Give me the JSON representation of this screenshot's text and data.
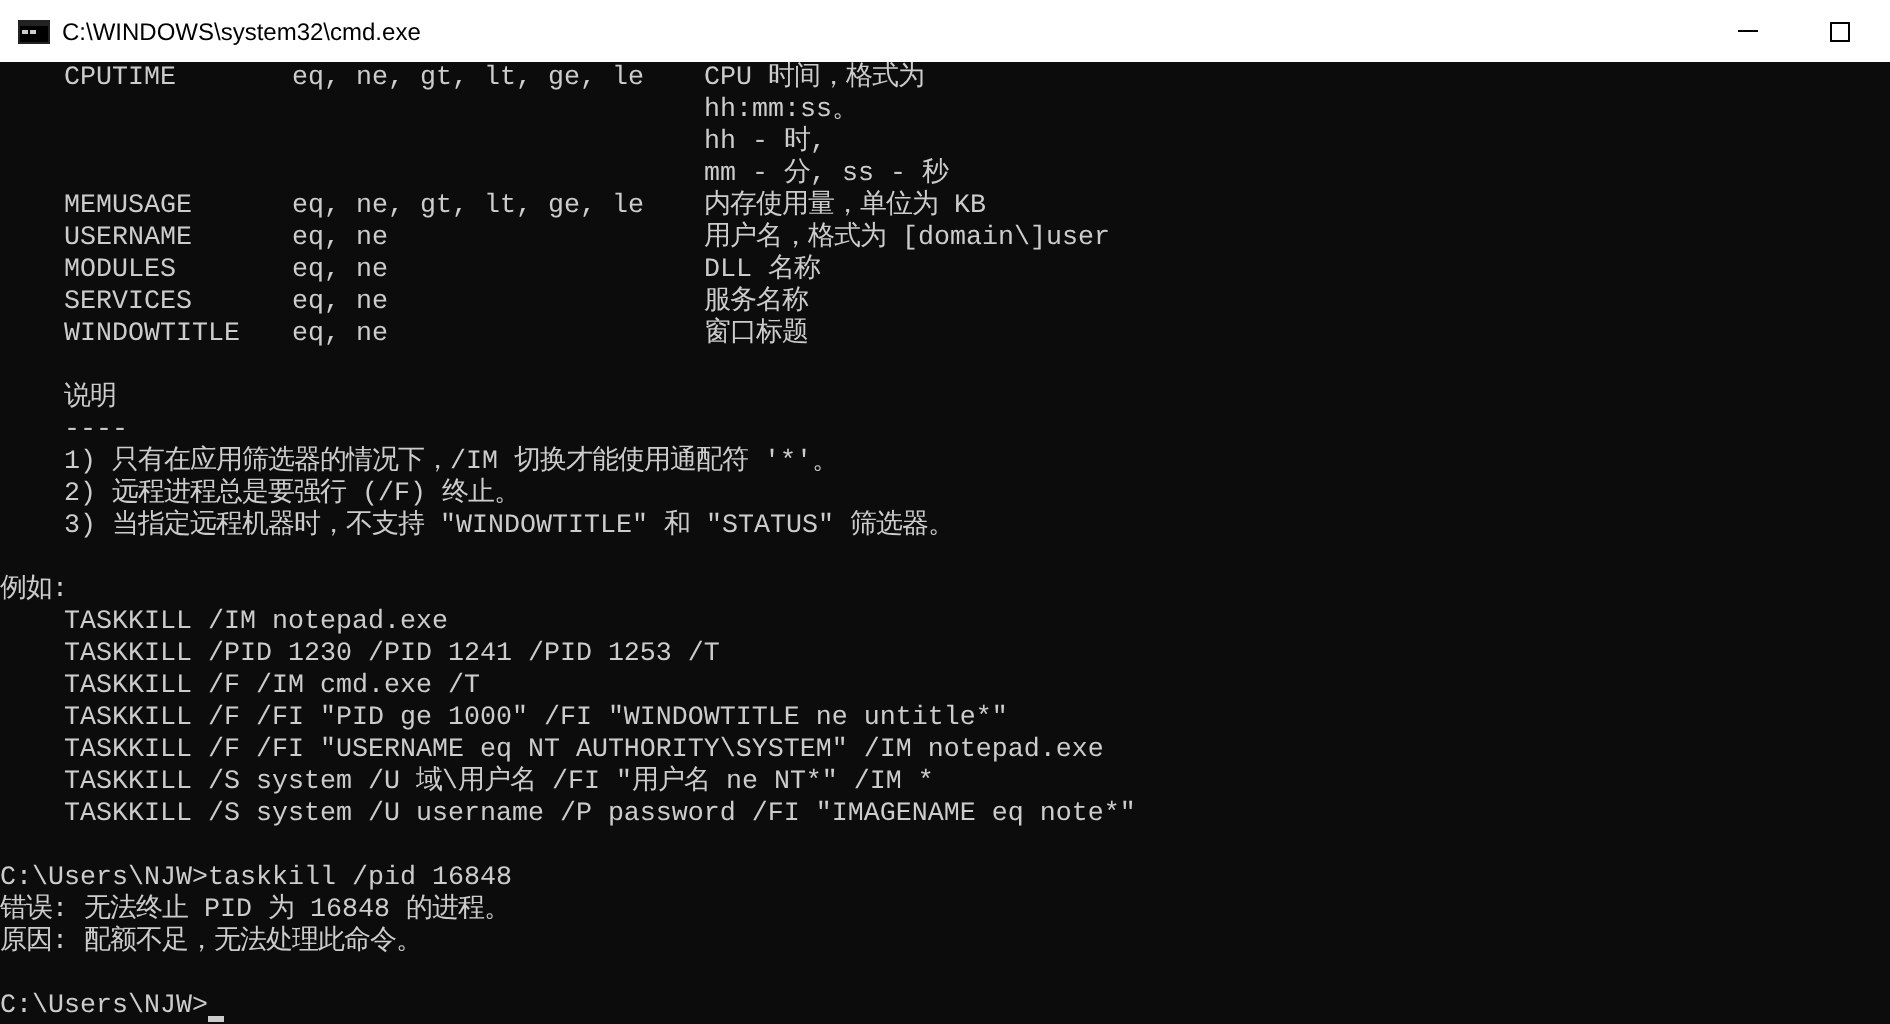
{
  "window": {
    "title": "C:\\WINDOWS\\system32\\cmd.exe"
  },
  "filters": [
    {
      "name": "CPUTIME",
      "operators": "eq, ne, gt, lt, ge, le",
      "description": [
        "CPU 时间，格式为",
        "hh:mm:ss。",
        "hh - 时,",
        "mm - 分, ss - 秒"
      ]
    },
    {
      "name": "MEMUSAGE",
      "operators": "eq, ne, gt, lt, ge, le",
      "description": [
        "内存使用量，单位为 KB"
      ]
    },
    {
      "name": "USERNAME",
      "operators": "eq, ne",
      "description": [
        "用户名，格式为 [domain\\]user"
      ]
    },
    {
      "name": "MODULES",
      "operators": "eq, ne",
      "description": [
        "DLL 名称"
      ]
    },
    {
      "name": "SERVICES",
      "operators": "eq, ne",
      "description": [
        "服务名称"
      ]
    },
    {
      "name": "WINDOWTITLE",
      "operators": "eq, ne",
      "description": [
        "窗口标题"
      ]
    }
  ],
  "notes": {
    "heading": "说明",
    "rule": "----",
    "items": [
      "1) 只有在应用筛选器的情况下，/IM 切换才能使用通配符 '*'。",
      "2) 远程进程总是要强行 (/F) 终止。",
      "3) 当指定远程机器时，不支持 \"WINDOWTITLE\" 和 \"STATUS\" 筛选器。"
    ]
  },
  "examples": {
    "heading": "例如:",
    "items": [
      "TASKKILL /IM notepad.exe",
      "TASKKILL /PID 1230 /PID 1241 /PID 1253 /T",
      "TASKKILL /F /IM cmd.exe /T",
      "TASKKILL /F /FI \"PID ge 1000\" /FI \"WINDOWTITLE ne untitle*\"",
      "TASKKILL /F /FI \"USERNAME eq NT AUTHORITY\\SYSTEM\" /IM notepad.exe",
      "TASKKILL /S system /U 域\\用户名 /FI \"用户名 ne NT*\" /IM *",
      "TASKKILL /S system /U username /P password /FI \"IMAGENAME eq note*\""
    ]
  },
  "session": {
    "command_line": "C:\\Users\\NJW>taskkill /pid 16848",
    "output": [
      "错误: 无法终止 PID 为 16848 的进程。",
      "原因: 配额不足，无法处理此命令。"
    ],
    "prompt": "C:\\Users\\NJW>"
  }
}
